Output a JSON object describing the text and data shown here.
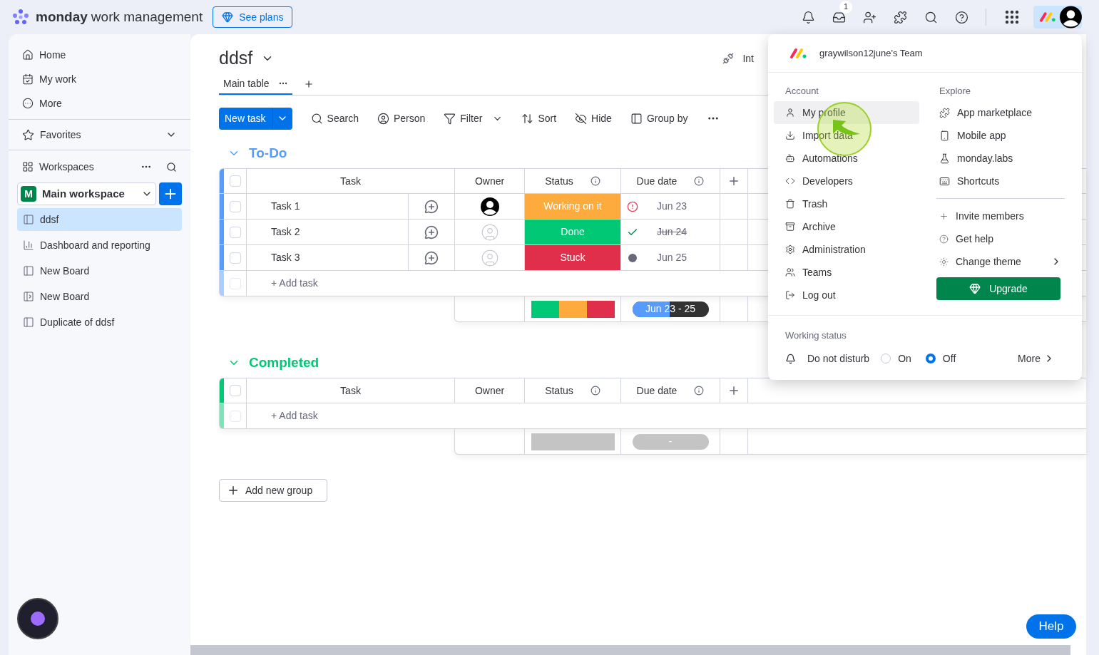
{
  "topbar": {
    "brand_bold": "monday",
    "brand_rest": "work management",
    "see_plans": "See plans",
    "inbox_badge": "1"
  },
  "sidebar": {
    "nav": [
      {
        "label": "Home",
        "kind": "home"
      },
      {
        "label": "My work",
        "kind": "calendar"
      },
      {
        "label": "More",
        "kind": "more"
      }
    ],
    "favorites": "Favorites",
    "workspaces": "Workspaces",
    "workspace_initial": "M",
    "workspace_name": "Main workspace",
    "boards": [
      {
        "label": "ddsf",
        "kind": "board",
        "selected": true
      },
      {
        "label": "Dashboard and reporting",
        "kind": "dashboard",
        "selected": false
      },
      {
        "label": "New Board",
        "kind": "board",
        "selected": false
      },
      {
        "label": "New Board",
        "kind": "shared",
        "selected": false
      },
      {
        "label": "Duplicate of ddsf",
        "kind": "board",
        "selected": false
      }
    ]
  },
  "board": {
    "title": "ddsf",
    "views": [
      {
        "label": "Main table",
        "selected": true
      }
    ],
    "integrate": "Int",
    "new_task": "New task",
    "toolbar": [
      {
        "label": "Search",
        "kind": "search"
      },
      {
        "label": "Person",
        "kind": "person"
      },
      {
        "label": "Filter",
        "kind": "filter"
      },
      {
        "label": "Sort",
        "kind": "sort"
      },
      {
        "label": "Hide",
        "kind": "hide"
      },
      {
        "label": "Group by",
        "kind": "group"
      }
    ],
    "groups": [
      {
        "title": "To-Do",
        "color": "#579bfc",
        "columns": [
          {
            "label": "Task"
          },
          {
            "label": "Owner"
          },
          {
            "label": "Status",
            "info": true
          },
          {
            "label": "Due date",
            "info": true
          }
        ],
        "all_checked": false,
        "rows": [
          {
            "checked": false,
            "task": "Task 1",
            "assigned": true,
            "status": "Working on it",
            "color": "#fdab3d",
            "due": "Jun 23",
            "overdue": true,
            "done": false
          },
          {
            "checked": false,
            "task": "Task 2",
            "assigned": false,
            "status": "Done",
            "color": "#00c875",
            "due": "Jun 24",
            "overdue": false,
            "done": true
          },
          {
            "checked": false,
            "task": "Task 3",
            "assigned": false,
            "status": "Stuck",
            "color": "#df2f4a",
            "due": "Jun 25",
            "overdue": false,
            "done": false
          }
        ],
        "add_row_checked": false,
        "add_task": "+ Add task",
        "summary": {
          "segments": [
            {
              "color": "#00c875"
            },
            {
              "color": "#fdab3d"
            },
            {
              "color": "#df2f4a"
            }
          ],
          "timeline": "Jun 23 - 25",
          "level": 0.49,
          "empty": false
        }
      },
      {
        "title": "Completed",
        "color": "#00c875",
        "columns": [
          {
            "label": "Task"
          },
          {
            "label": "Owner"
          },
          {
            "label": "Status",
            "info": true
          },
          {
            "label": "Due date",
            "info": true
          }
        ],
        "all_checked": false,
        "add_row_checked": false,
        "add_task": "+ Add task",
        "summary": {
          "segments": [
            {
              "color": "#c4c4c4"
            }
          ],
          "timeline": "-",
          "empty": true
        }
      }
    ],
    "add_group": "Add new group"
  },
  "menu": {
    "team": "graywilson12june's Team",
    "account_title": "Account",
    "account": [
      {
        "label": "My profile",
        "kind": "user",
        "selected": true
      },
      {
        "label": "Import data",
        "kind": "import",
        "selected": false
      },
      {
        "label": "Automations",
        "kind": "bot",
        "selected": false
      },
      {
        "label": "Developers",
        "kind": "code",
        "selected": false
      },
      {
        "label": "Trash",
        "kind": "trash",
        "selected": false
      },
      {
        "label": "Archive",
        "kind": "archive",
        "selected": false
      },
      {
        "label": "Administration",
        "kind": "settings",
        "selected": false
      },
      {
        "label": "Teams",
        "kind": "users",
        "selected": false
      },
      {
        "label": "Log out",
        "kind": "logout",
        "selected": false
      }
    ],
    "explore_title": "Explore",
    "explore": [
      {
        "label": "App marketplace",
        "kind": "puzzle"
      },
      {
        "label": "Mobile app",
        "kind": "phone"
      },
      {
        "label": "monday.labs",
        "kind": "flask"
      },
      {
        "label": "Shortcuts",
        "kind": "keyboard"
      }
    ],
    "more": [
      {
        "label": "Invite members",
        "kind": "plus",
        "submenu": false
      },
      {
        "label": "Get help",
        "kind": "help",
        "submenu": false
      },
      {
        "label": "Change theme",
        "kind": "sun",
        "submenu": true
      }
    ],
    "upgrade": "Upgrade",
    "working_status": "Working status",
    "dnd": "Do not disturb",
    "options": [
      {
        "label": "On",
        "selected": false
      },
      {
        "label": "Off",
        "selected": true
      }
    ],
    "more_link": "More"
  },
  "help": "Help"
}
